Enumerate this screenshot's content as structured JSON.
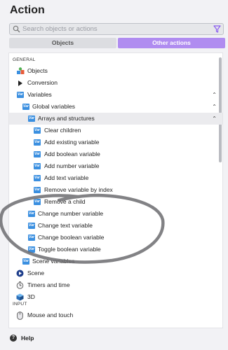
{
  "header": {
    "title": "Action"
  },
  "search": {
    "placeholder": "Search objects or actions"
  },
  "tabs": {
    "objects": "Objects",
    "other_actions": "Other actions"
  },
  "sections": {
    "general": "GENERAL",
    "input": "INPUT"
  },
  "tree": {
    "objects": "Objects",
    "conversion": "Conversion",
    "variables": "Variables",
    "global_variables": "Global variables",
    "arrays_and_structures": "Arrays and structures",
    "clear_children": "Clear children",
    "add_existing_variable": "Add existing variable",
    "add_boolean_variable": "Add boolean variable",
    "add_number_variable": "Add number variable",
    "add_text_variable": "Add text variable",
    "remove_variable_by_index": "Remove variable by index",
    "remove_a_child": "Remove a child",
    "change_number_variable": "Change number variable",
    "change_text_variable": "Change text variable",
    "change_boolean_variable": "Change boolean variable",
    "toggle_boolean_variable": "Toggle boolean variable",
    "scene_variables": "Scene variables",
    "scene": "Scene",
    "timers_and_time": "Timers and time",
    "three_d": "3D",
    "mouse_and_touch": "Mouse and touch"
  },
  "icons": {
    "variable_badge": "Var"
  },
  "footer": {
    "help": "Help"
  },
  "colors": {
    "accent": "#b08cf0",
    "variable_icon": "#3a8fe0"
  }
}
